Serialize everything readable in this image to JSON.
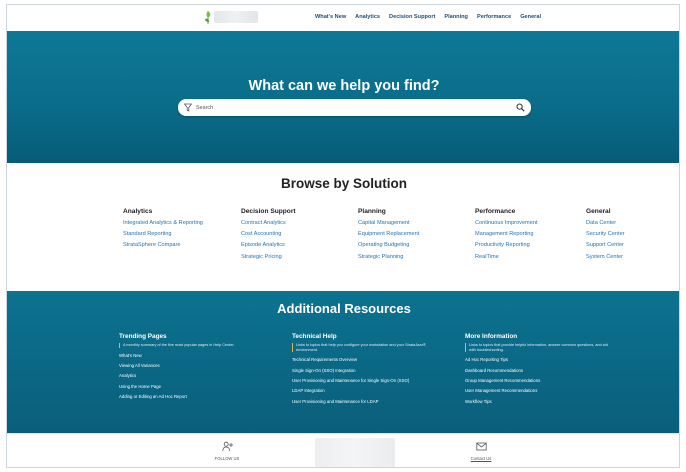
{
  "nav": {
    "links": [
      "What's New",
      "Analytics",
      "Decision Support",
      "Planning",
      "Performance",
      "General"
    ]
  },
  "hero": {
    "title": "What can we help you find?",
    "search_placeholder": "Search"
  },
  "browse": {
    "title": "Browse by Solution",
    "columns": [
      {
        "heading": "Analytics",
        "links": [
          "Integrated Analytics & Reporting",
          "Standard Reporting",
          "StrataSphere Compare"
        ]
      },
      {
        "heading": "Decision Support",
        "links": [
          "Contract Analytics",
          "Cost Accounting",
          "Episode Analytics",
          "Strategic Pricing"
        ]
      },
      {
        "heading": "Planning",
        "links": [
          "Capital Management",
          "Equipment Replacement",
          "Operating Budgeting",
          "Strategic Planning"
        ]
      },
      {
        "heading": "Performance",
        "links": [
          "Continuous Improvement",
          "Management Reporting",
          "Productivity Reporting",
          "RealTime"
        ]
      },
      {
        "heading": "General",
        "links": [
          "Data Center",
          "Security Center",
          "Support Center",
          "System Center"
        ]
      }
    ]
  },
  "resources": {
    "title": "Additional Resources",
    "columns": [
      {
        "heading": "Trending Pages",
        "description": "A monthly summary of the five most popular pages in Help Center.",
        "links": [
          "What's New",
          "Viewing All Variances",
          "Analytics",
          "Using the Home Page",
          "Adding or Editing an Ad Hoc Report"
        ]
      },
      {
        "heading": "Technical Help",
        "description": "Links to topics that help you configure your workstation and your StrataJazz® environment.",
        "links": [
          "Technical Requirements Overview",
          "Single Sign-On (SSO) Integration",
          "User Provisioning and Maintenance for Single Sign-On (SSO)",
          "LDAP Integration",
          "User Provisioning and Maintenance for LDAP"
        ]
      },
      {
        "heading": "More Information",
        "description": "Links to topics that provide helpful information, answer common questions, and aid with troubleshooting.",
        "links": [
          "Ad Hoc Reporting Tips",
          "Dashboard Recommendations",
          "Group Management Recommendations",
          "User Management Recommendations",
          "Workflow Tips"
        ]
      }
    ]
  },
  "footer": {
    "follow_label": "FOLLOW US",
    "contact_label": "Contact Us"
  },
  "colors": {
    "hero_bg": "#0a6d8a",
    "link_blue": "#1e73b8",
    "accent_yellow": "#e6b23a"
  },
  "icons": {
    "logo": "leaf-logo-icon",
    "filter": "filter-icon",
    "search": "search-icon",
    "follow": "add-user-icon",
    "contact": "envelope-icon"
  }
}
